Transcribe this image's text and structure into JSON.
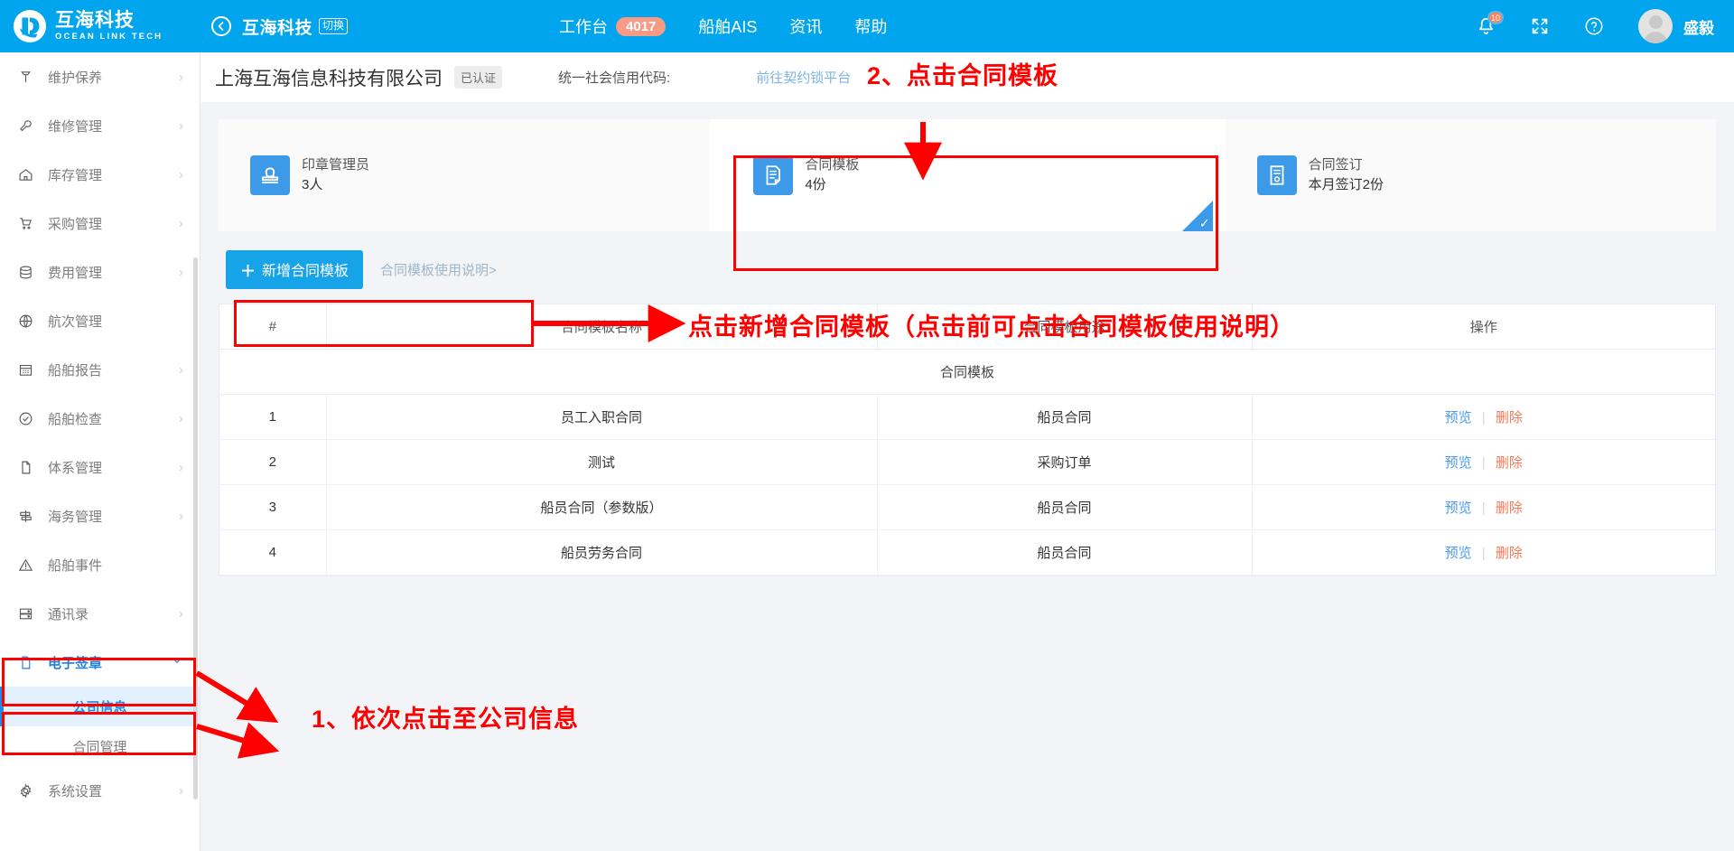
{
  "topbar": {
    "brand_cn": "互海科技",
    "brand_en": "OCEAN LINK TECH",
    "back_icon": "back-arrow-icon",
    "company_switch_name": "互海科技",
    "switch_badge": "切换",
    "nav": [
      {
        "label": "工作台",
        "badge": "4017"
      },
      {
        "label": "船舶AIS",
        "badge": ""
      },
      {
        "label": "资讯",
        "badge": ""
      },
      {
        "label": "帮助",
        "badge": ""
      }
    ],
    "bell_icon": "bell-icon",
    "bell_badge": "10",
    "fullscreen_icon": "fullscreen-icon",
    "help_icon": "question-circle-icon",
    "avatar_icon": "avatar",
    "username": "盛毅"
  },
  "sidebar": {
    "items": [
      {
        "label": "维护保养",
        "icon": "wrench-hammer-icon",
        "arrow": "chevron-right",
        "state": "normal"
      },
      {
        "label": "维修管理",
        "icon": "wrench-icon",
        "arrow": "chevron-right",
        "state": "normal"
      },
      {
        "label": "库存管理",
        "icon": "home-icon",
        "arrow": "chevron-right",
        "state": "normal"
      },
      {
        "label": "采购管理",
        "icon": "cart-icon",
        "arrow": "chevron-right",
        "state": "normal"
      },
      {
        "label": "费用管理",
        "icon": "database-icon",
        "arrow": "chevron-right",
        "state": "normal"
      },
      {
        "label": "航次管理",
        "icon": "globe-icon",
        "arrow": "",
        "state": "normal"
      },
      {
        "label": "船舶报告",
        "icon": "calendar-icon",
        "arrow": "chevron-right",
        "state": "normal"
      },
      {
        "label": "船舶检查",
        "icon": "check-circle-icon",
        "arrow": "chevron-right",
        "state": "normal"
      },
      {
        "label": "体系管理",
        "icon": "documents-icon",
        "arrow": "chevron-right",
        "state": "normal"
      },
      {
        "label": "海务管理",
        "icon": "signpost-icon",
        "arrow": "chevron-right",
        "state": "normal"
      },
      {
        "label": "船舶事件",
        "icon": "warning-icon",
        "arrow": "",
        "state": "normal"
      },
      {
        "label": "通讯录",
        "icon": "contacts-icon",
        "arrow": "chevron-right",
        "state": "normal"
      },
      {
        "label": "电子签章",
        "icon": "documents-icon",
        "arrow": "chevron-down",
        "state": "active"
      }
    ],
    "submenu": [
      {
        "label": "公司信息",
        "state": "selected"
      },
      {
        "label": "合同管理",
        "state": "normal"
      }
    ],
    "footer_item": {
      "label": "系统设置",
      "icon": "gear-icon",
      "arrow": "chevron-right"
    }
  },
  "company_bar": {
    "name": "上海互海信息科技有限公司",
    "cert_badge": "已认证",
    "credit_label": "统一社会信用代码:",
    "credit_link": "前往契约锁平台"
  },
  "cards": [
    {
      "icon": "stamp-icon",
      "title": "印章管理员",
      "sub": "3人",
      "selected": false
    },
    {
      "icon": "document-icon",
      "title": "合同模板",
      "sub": "4份",
      "selected": true
    },
    {
      "icon": "contract-icon",
      "title": "合同签订",
      "sub": "本月签订2份",
      "selected": false
    }
  ],
  "toolbar": {
    "add_button_label": "新增合同模板",
    "add_button_plus": "＋",
    "help_link_label": "合同模板使用说明>"
  },
  "table": {
    "title": "合同模板",
    "columns": [
      "#",
      "合同模板名称",
      "合同模板用途",
      "操作"
    ],
    "actions": {
      "preview": "预览",
      "separator": "|",
      "delete": "删除"
    },
    "rows": [
      {
        "idx": "1",
        "name": "员工入职合同",
        "use": "船员合同"
      },
      {
        "idx": "2",
        "name": "测试",
        "use": "采购订单"
      },
      {
        "idx": "3",
        "name": "船员合同（参数版）",
        "use": "船员合同"
      },
      {
        "idx": "4",
        "name": "船员劳务合同",
        "use": "船员合同"
      }
    ]
  },
  "annotations": {
    "step1": "1、依次点击至公司信息",
    "step2": "2、点击合同模板",
    "step3": "点击新增合同模板（点击前可点击合同模板使用说明）",
    "color": "#ff0000"
  }
}
